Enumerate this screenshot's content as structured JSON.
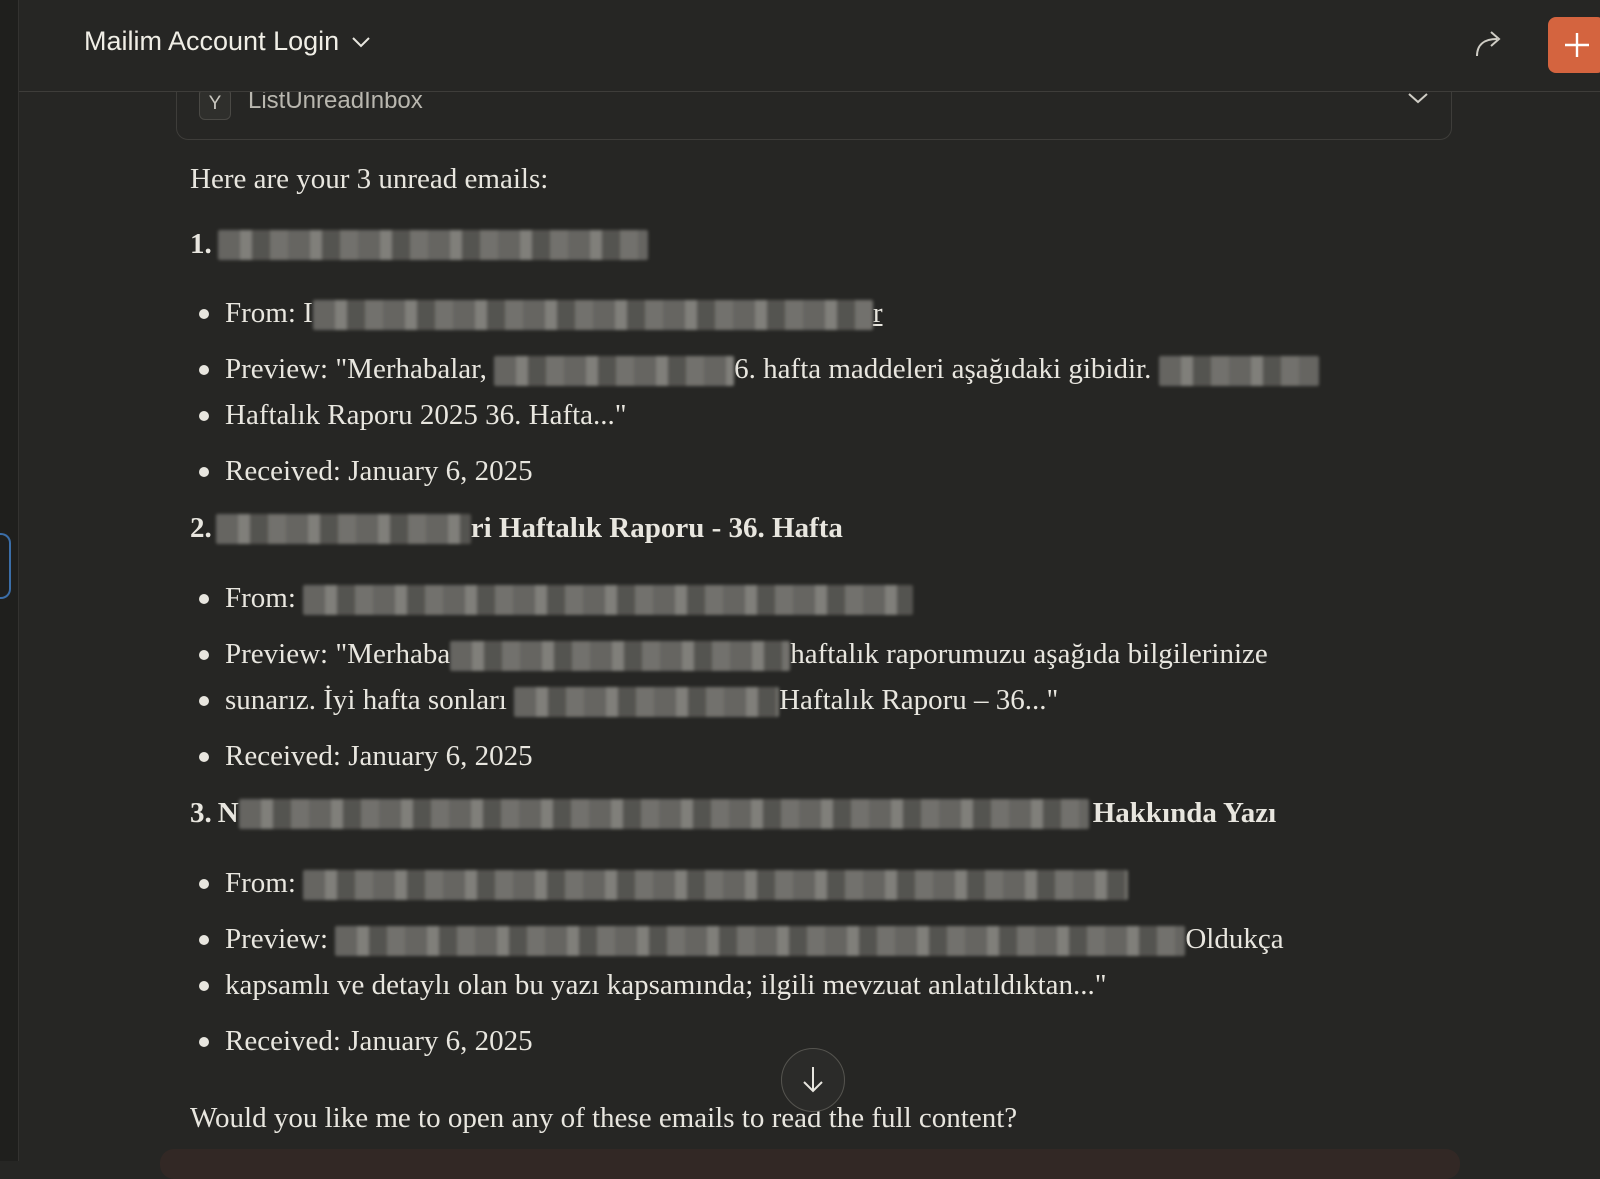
{
  "header": {
    "title": "Mailim Account Login",
    "share_icon": "share-arrow-icon",
    "new_chat_icon": "plus-icon",
    "accent_color": "#d4643f"
  },
  "tool_call": {
    "badge": "Y",
    "name": "ListUnreadInbox"
  },
  "message": {
    "intro": "Here are your 3 unread emails:",
    "emails": [
      {
        "number": "1.",
        "subject_visible": "",
        "from_label": "From:",
        "from_visible_start": "I",
        "from_visible_end": "r",
        "preview_label": "Preview:",
        "preview_a": "\"Merhabalar,",
        "preview_b": "6. hafta maddeleri aşağıdaki gibidir.",
        "preview_line2": "Haftalık Raporu 2025 36. Hafta...\"",
        "received": "Received: January 6, 2025"
      },
      {
        "number": "2.",
        "subject_visible": "ri Haftalık Raporu - 36. Hafta",
        "from_label": "From:",
        "preview_label": "Preview:",
        "preview_a": "\"Merhaba",
        "preview_b": "haftalık raporumuzu aşağıda bilgilerinize",
        "preview_line2a": "sunarız. İyi hafta sonları",
        "preview_line2b": "Haftalık Raporu – 36...\"",
        "received": "Received: January 6, 2025"
      },
      {
        "number": "3.",
        "subject_visible_start": "N",
        "subject_visible": "Hakkında Yazı",
        "from_label": "From:",
        "preview_label": "Preview:",
        "preview_b": "Oldukça",
        "preview_line2": "kapsamlı ve detaylı olan bu yazı kapsamında; ilgili mevzuat anlatıldıktan...\"",
        "received": "Received: January 6, 2025"
      }
    ],
    "closing": "Would you like me to open any of these emails to read the full content?"
  },
  "scroll_button_icon": "arrow-down-icon"
}
